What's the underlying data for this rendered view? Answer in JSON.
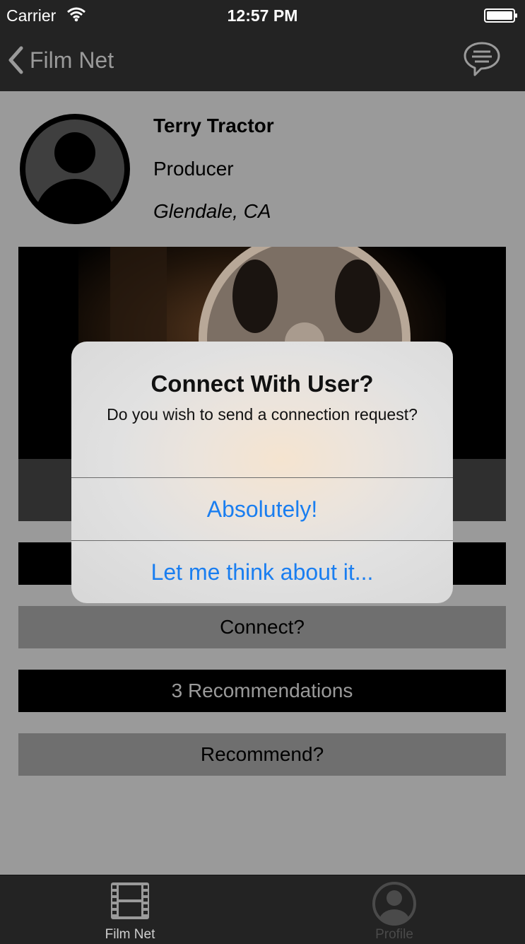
{
  "status_bar": {
    "carrier": "Carrier",
    "time": "12:57 PM"
  },
  "nav": {
    "back_label": "Film Net",
    "chat_icon": "chat-bubble-icon"
  },
  "profile": {
    "name": "Terry Tractor",
    "role": "Producer",
    "location": "Glendale, CA",
    "avatar_icon": "person-avatar-icon"
  },
  "buttons": {
    "connect": "Connect?",
    "recommendations": "3 Recommendations",
    "recommend": "Recommend?"
  },
  "alert": {
    "title": "Connect With User?",
    "message": "Do you wish to send a connection request?",
    "primary": "Absolutely!",
    "secondary": "Let me think about it..."
  },
  "tabbar": {
    "tabs": [
      {
        "label": "Film Net",
        "icon": "film-strip-icon",
        "active": true
      },
      {
        "label": "Profile",
        "icon": "profile-icon",
        "active": false
      }
    ]
  },
  "colors": {
    "accent": "#1a7ef0",
    "background": "#9a9a9a",
    "bar": "#232323"
  }
}
